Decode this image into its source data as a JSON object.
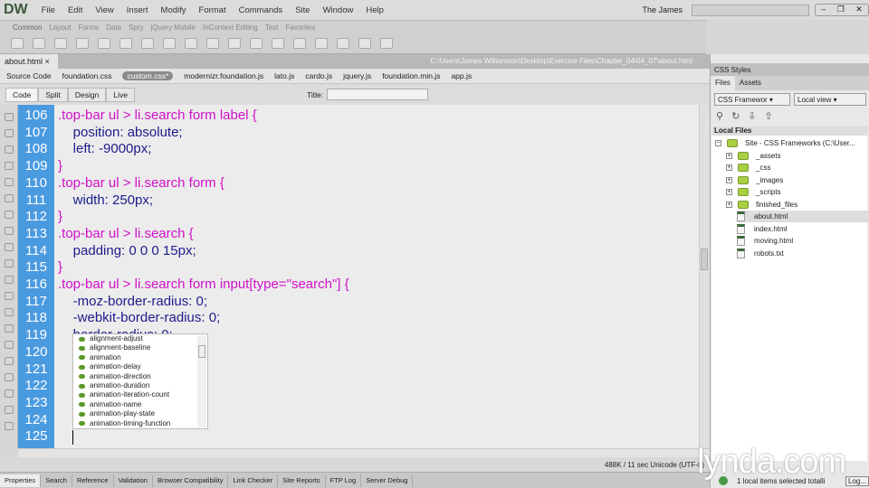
{
  "app": {
    "logo": "DW",
    "menu": [
      "File",
      "Edit",
      "View",
      "Insert",
      "Modify",
      "Format",
      "Commands",
      "Site",
      "Window",
      "Help"
    ],
    "user": "The James",
    "search_placeholder": ""
  },
  "insert_tabs": [
    "Common",
    "Layout",
    "Forms",
    "Data",
    "Spry",
    "jQuery Mobile",
    "InContext Editing",
    "Text",
    "Favorites"
  ],
  "document": {
    "tab": "about.html",
    "close": "×",
    "path": "C:\\Users\\James Williamson\\Desktop\\Exercise Files\\Chapter_04\\04_07\\about.html",
    "related_files": [
      "Source Code",
      "foundation.css",
      "custom.css*",
      "modernizr.foundation.js",
      "lato.js",
      "cardo.js",
      "jquery.js",
      "foundation.min.js",
      "app.js"
    ],
    "views": [
      "Code",
      "Split",
      "Design",
      "Live"
    ],
    "title_label": "Title:",
    "title_value": ""
  },
  "code": {
    "lines": [
      {
        "n": "106",
        "t": ".top-bar ul > li.search form label {",
        "sel": true
      },
      {
        "n": "107",
        "t": "    position: absolute;"
      },
      {
        "n": "108",
        "t": "    left: -9000px;"
      },
      {
        "n": "109",
        "t": "}",
        "sel": true
      },
      {
        "n": "110",
        "t": ".top-bar ul > li.search form {",
        "sel": true
      },
      {
        "n": "111",
        "t": "    width: 250px;"
      },
      {
        "n": "112",
        "t": "}",
        "sel": true
      },
      {
        "n": "113",
        "t": ".top-bar ul > li.search {",
        "sel": true
      },
      {
        "n": "114",
        "t": "    padding: 0 0 0 15px;"
      },
      {
        "n": "115",
        "t": "}",
        "sel": true
      },
      {
        "n": "116",
        "t": ".top-bar ul > li.search form input[type=\"search\"] {",
        "sel": true
      },
      {
        "n": "117",
        "t": "    -moz-border-radius: 0;"
      },
      {
        "n": "118",
        "t": "    -webkit-border-radius: 0;"
      },
      {
        "n": "119",
        "t": "    border-radius: 0;"
      },
      {
        "n": "120",
        "t": ""
      },
      {
        "n": "121",
        "t": ""
      },
      {
        "n": "122",
        "t": ""
      },
      {
        "n": "123",
        "t": ""
      },
      {
        "n": "124",
        "t": ""
      },
      {
        "n": "125",
        "t": ""
      }
    ]
  },
  "code_hints": [
    "alignment-adjust",
    "alignment-baseline",
    "animation",
    "animation-delay",
    "animation-direction",
    "animation-duration",
    "animation-iteration-count",
    "animation-name",
    "animation-play-state",
    "animation-timing-function"
  ],
  "status": {
    "text": "488K / 11 sec  Unicode (UTF-8)"
  },
  "bottom_tabs": [
    "Properties",
    "Search",
    "Reference",
    "Validation",
    "Browser Compatibility",
    "Link Checker",
    "Site Reports",
    "FTP Log",
    "Server Debug"
  ],
  "panel": {
    "css_styles": "CSS Styles",
    "tabs": [
      "Files",
      "Assets"
    ],
    "site_select": "CSS Framewor",
    "view_select": "Local view",
    "local_files": "Local Files",
    "tree": [
      {
        "label": "Site - CSS Frameworks (C:\\User...",
        "type": "site"
      },
      {
        "label": "_assets",
        "type": "folder"
      },
      {
        "label": "_css",
        "type": "folder"
      },
      {
        "label": "_images",
        "type": "folder"
      },
      {
        "label": "_scripts",
        "type": "folder"
      },
      {
        "label": "finished_files",
        "type": "folder"
      },
      {
        "label": "about.html",
        "type": "html",
        "selected": true
      },
      {
        "label": "index.html",
        "type": "html"
      },
      {
        "label": "moving.html",
        "type": "html"
      },
      {
        "label": "robots.txt",
        "type": "txt"
      }
    ],
    "status": "1 local items selected totalli",
    "log_button": "Log..."
  },
  "watermark": "lynda.com",
  "colors": {
    "gutter": "#4a9ae0",
    "selector": "#d010c8",
    "property": "#1c1c8c"
  }
}
